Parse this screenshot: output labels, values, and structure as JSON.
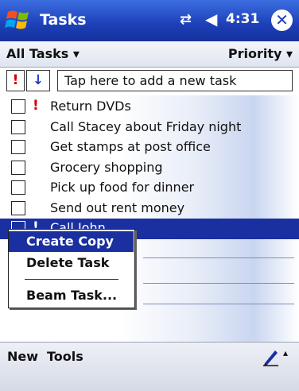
{
  "titlebar": {
    "title": "Tasks",
    "connectivity_glyph": "⇄",
    "volume_glyph": "◀",
    "time": "4:31",
    "close_glyph": "✕"
  },
  "filterbar": {
    "category": "All Tasks ▾",
    "sort": "Priority ▾"
  },
  "entrybar": {
    "high_priority_glyph": "!",
    "low_priority_glyph": "↓",
    "placeholder": "Tap here to add a new task"
  },
  "tasks": [
    {
      "label": "Return DVDs",
      "priority": "!",
      "checked": false
    },
    {
      "label": "Call Stacey about Friday night",
      "priority": "",
      "checked": false
    },
    {
      "label": "Get stamps at post office",
      "priority": "",
      "checked": false
    },
    {
      "label": "Grocery shopping",
      "priority": "",
      "checked": false
    },
    {
      "label": "Pick up food for dinner",
      "priority": "",
      "checked": false
    },
    {
      "label": "Send out rent money",
      "priority": "",
      "checked": false
    },
    {
      "label": "Call John",
      "priority": "!",
      "checked": false,
      "selected": true
    }
  ],
  "context_menu": {
    "items": [
      "Create Copy",
      "Delete Task",
      "Beam Task..."
    ]
  },
  "toolbar": {
    "new_label": "New",
    "tools_label": "Tools",
    "sip_arrow": "▴"
  },
  "colors": {
    "titlebar": "#1c3fb8",
    "selection": "#1a2fa0",
    "priority_red": "#cc0000"
  }
}
